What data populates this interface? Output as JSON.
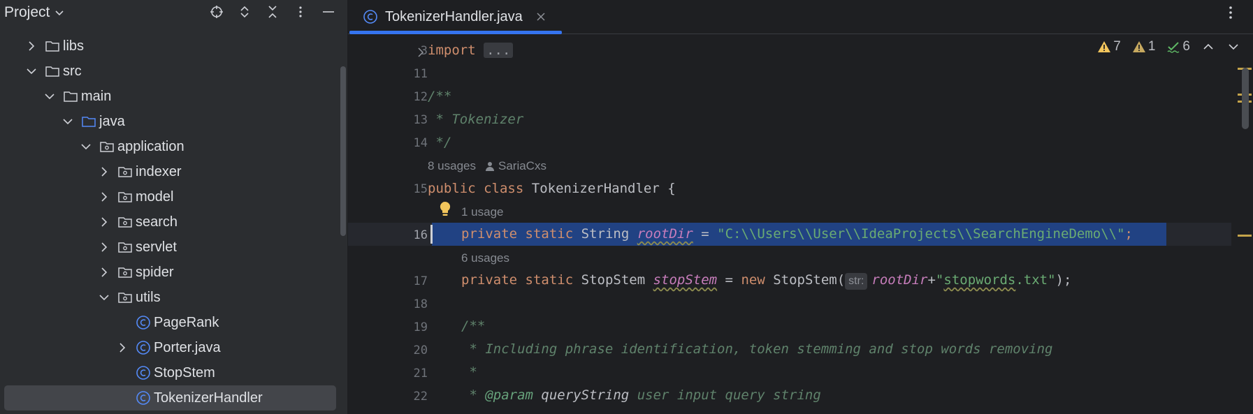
{
  "panel": {
    "title": "Project",
    "tools": [
      "locate-icon",
      "expand-all-icon",
      "collapse-all-icon",
      "more-vertical-icon",
      "minimize-icon"
    ]
  },
  "tree": [
    {
      "label": "libs",
      "depth": 1,
      "expanded": false,
      "icon": "folder-icon"
    },
    {
      "label": "src",
      "depth": 1,
      "expanded": true,
      "icon": "folder-icon"
    },
    {
      "label": "main",
      "depth": 2,
      "expanded": true,
      "icon": "folder-icon"
    },
    {
      "label": "java",
      "depth": 3,
      "expanded": true,
      "icon": "source-folder-icon"
    },
    {
      "label": "application",
      "depth": 4,
      "expanded": true,
      "icon": "package-icon"
    },
    {
      "label": "indexer",
      "depth": 5,
      "expanded": false,
      "icon": "package-icon"
    },
    {
      "label": "model",
      "depth": 5,
      "expanded": false,
      "icon": "package-icon"
    },
    {
      "label": "search",
      "depth": 5,
      "expanded": false,
      "icon": "package-icon"
    },
    {
      "label": "servlet",
      "depth": 5,
      "expanded": false,
      "icon": "package-icon"
    },
    {
      "label": "spider",
      "depth": 5,
      "expanded": false,
      "icon": "package-icon"
    },
    {
      "label": "utils",
      "depth": 5,
      "expanded": true,
      "icon": "package-icon"
    },
    {
      "label": "PageRank",
      "depth": 6,
      "expanded": null,
      "icon": "class-icon"
    },
    {
      "label": "Porter.java",
      "depth": 6,
      "expanded": false,
      "icon": "class-icon"
    },
    {
      "label": "StopStem",
      "depth": 6,
      "expanded": null,
      "icon": "class-icon"
    },
    {
      "label": "TokenizerHandler",
      "depth": 6,
      "expanded": null,
      "icon": "class-icon",
      "selected": true
    }
  ],
  "editor": {
    "tab_label": "TokenizerHandler.java",
    "inspections": {
      "warnings": "7",
      "weak_warnings": "1",
      "typos": "6"
    },
    "line_numbers": {
      "l3": "3",
      "l11": "11",
      "l12": "12",
      "l13": "13",
      "l14": "14",
      "l15": "15",
      "l16": "16",
      "l17": "17",
      "l18": "18",
      "l19": "19",
      "l20": "20",
      "l21": "21",
      "l22": "22"
    },
    "code": {
      "import_kw": "import",
      "import_fold": "...",
      "doc_open": "/**",
      "doc_tokenizer": " * Tokenizer",
      "doc_close": " */",
      "class_usages": "8 usages",
      "class_author": "SariaCxs",
      "kw_public": "public",
      "kw_class": "class",
      "class_name": "TokenizerHandler {",
      "field1_usages": "1 usage",
      "kw_private": "private",
      "kw_static": "static",
      "type_string": "String",
      "field_rootdir": "rootDir",
      "assign": " = ",
      "str_rootdir": "\"C:\\\\Users\\\\User\\\\IdeaProjects\\\\SearchEngineDemo\\\\\"",
      "semicolon": ";",
      "field2_usages": "6 usages",
      "type_stopstem": "StopStem",
      "field_stopstem": "stopStem",
      "kw_new": "new",
      "ctor_call": "StopStem(",
      "param_hint": "str:",
      "concat": "+",
      "str_q_open": "\"",
      "str_stopwords": "stopwords",
      "str_rest": ".txt\"",
      "call_close": ");",
      "doc2_open": "/**",
      "doc2_line1": " * Including phrase identification, token stemming and stop words removing",
      "doc2_line2": " *",
      "doc2_prefix": " * ",
      "doc2_tag": "@param",
      "doc2_param": "queryString",
      "doc2_desc": "user input query string"
    }
  },
  "colors": {
    "accent": "#3574f0",
    "keyword": "#cf8e6d",
    "string": "#6aab73",
    "field": "#c77dbb",
    "doc_comment": "#5f826b",
    "selection": "#214283",
    "warning": "#c5a44a"
  }
}
